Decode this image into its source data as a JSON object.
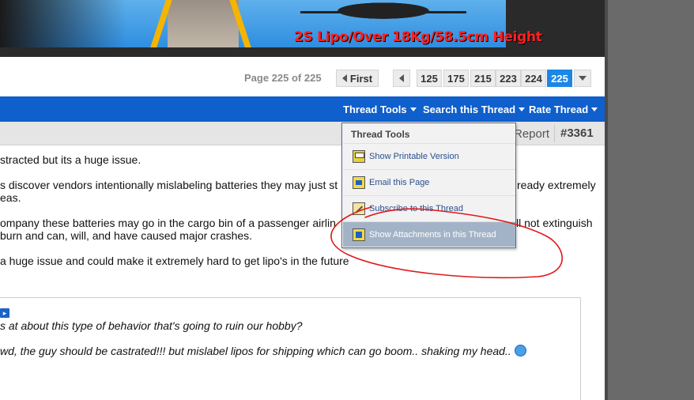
{
  "banner": {
    "caption": "2S Lipo/Over 18Kg/58.5cm Height"
  },
  "pagination": {
    "label": "Page 225 of 225",
    "first_label": "First",
    "pages": [
      "125",
      "175",
      "215",
      "223",
      "224",
      "225"
    ],
    "current_page": "225"
  },
  "toolbar": {
    "thread_tools": "Thread Tools",
    "search_thread": "Search this Thread",
    "rate_thread": "Rate Thread"
  },
  "post_header": {
    "report": "Report",
    "post_number": "#3361"
  },
  "post": {
    "lines": [
      "stracted but its a huge issue.",
      "s discover vendors intentionally mislabeling batteries they may just st",
      "eas.",
      "ompany these batteries may go in the cargo bin of a passenger airlin",
      "burn and can, will, and have caused major crashes.",
      "a huge issue and could make it extremely hard to get lipo's in the future"
    ],
    "line2_tail": "ready extremely",
    "line4_tail": "ll not extinguish"
  },
  "quote": {
    "line1": "s at about this type of behavior that's going to ruin our hobby?",
    "line2": "wd, the guy should be castrated!!! but mislabel lipos for shipping which can go boom.. shaking my head.."
  },
  "menu": {
    "title": "Thread Tools",
    "items": [
      {
        "label": "Show Printable Version",
        "icon": "printer-icon"
      },
      {
        "label": "Email this Page",
        "icon": "email-icon"
      },
      {
        "label": "Subscribe to this Thread",
        "icon": "subscribe-icon"
      },
      {
        "label": "Show Attachments in this Thread",
        "icon": "attachment-icon"
      }
    ],
    "highlighted_index": 3
  },
  "colors": {
    "toolbar_blue": "#0f5fcc",
    "current_page_blue": "#1b87e6",
    "annotation_red": "#e01818"
  }
}
